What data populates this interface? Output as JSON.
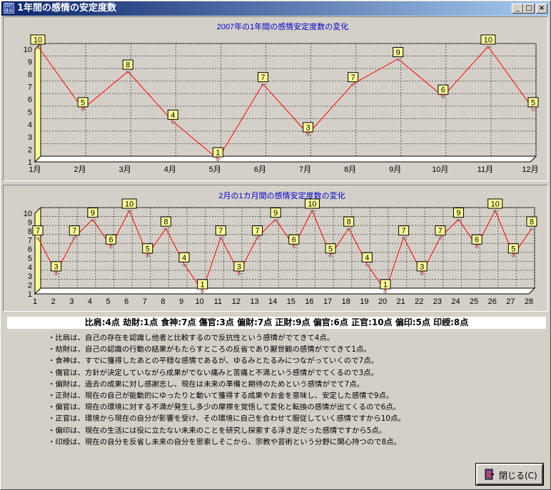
{
  "window": {
    "title": "1年間の感情の安定度数",
    "icon_text": "四柱推命",
    "controls": {
      "minimize": "_",
      "maximize": "□",
      "close": "×"
    }
  },
  "colors": {
    "line": "#ff0000",
    "floor": "#ffffff",
    "wall": "#ffff99",
    "plot_bg": "#d4d0c8",
    "title": "#0000cc",
    "label_bg": "#ffff99"
  },
  "chart_data": [
    {
      "type": "line",
      "title": "2007年の1年間の感情安定度数の変化",
      "categories": [
        "1月",
        "2月",
        "3月",
        "4月",
        "5月",
        "6月",
        "7月",
        "8月",
        "9月",
        "10月",
        "11月",
        "12月"
      ],
      "values": [
        10,
        5,
        8,
        4,
        1,
        7,
        3,
        7,
        9,
        6,
        10,
        5
      ],
      "yticks": [
        1,
        2,
        3,
        4,
        5,
        6,
        7,
        8,
        9,
        10
      ],
      "ylim": [
        1,
        10
      ],
      "grid": true,
      "style": "3d"
    },
    {
      "type": "line",
      "title": "2月の1カ月間の感情安定度数の変化",
      "categories": [
        "1",
        "2",
        "3",
        "4",
        "5",
        "6",
        "7",
        "8",
        "9",
        "10",
        "11",
        "12",
        "13",
        "14",
        "15",
        "16",
        "17",
        "18",
        "19",
        "20",
        "21",
        "22",
        "23",
        "24",
        "25",
        "26",
        "27",
        "28"
      ],
      "values": [
        7,
        3,
        7,
        9,
        6,
        10,
        5,
        8,
        4,
        1,
        7,
        3,
        7,
        9,
        6,
        10,
        5,
        8,
        4,
        1,
        7,
        3,
        7,
        9,
        6,
        10,
        5,
        8
      ],
      "yticks": [
        1,
        2,
        3,
        4,
        5,
        6,
        7,
        8,
        9,
        10
      ],
      "ylim": [
        1,
        10
      ],
      "grid": true,
      "style": "3d"
    }
  ],
  "summary": "比肩:4点  劫財:1点  食神:7点  傷官:3点  偏財:7点  正財:9点  偏官:6点  正官:10点  偏印:5点  印綬:8点",
  "descriptions": [
    "・比肩は、自己の存在を認識し他者と比較するので反抗性という感情がでてきて4点。",
    "・劫財は、自己の認識の行動の結果がもたらすところの反省であり厭世観の感情がでてきて1点。",
    "・食神は、すでに獲得したあとの平穏な感情であるが、ゆるみとたるみにつながっていくので7点。",
    "・傷官は、方針が決定していながら成果がでない痛みと苦痛と不満という感情がでてくるので3点。",
    "・偏財は、過去の成果に対し感謝志し、現在は未来の準備と期待のためという感情がでて7点。",
    "・正財は、現在の自己が能動的にゆったりと動いて獲得する成果やお金を意味し、安定した感情で9点。",
    "・偏官は、現在の環境に対する不満が発生し多少の摩擦を覚悟して変化と転換の感情が出てくるので6点。",
    "・正官は、環境から現在の自分が影響を受け、その環境に自己を合わせて服従していく感情ですから10点。",
    "・偏印は、現在の生活には役に立たない未来のことを研究し探索する浮き足だった感情ですから5点。",
    "・印綬は、現在の自分を反省し未来の自分を思索しそこから、宗教や芸術という分野に関心持つので8点。"
  ],
  "close_button": {
    "label": "閉じる(C)",
    "icon": "door-exit-icon"
  }
}
